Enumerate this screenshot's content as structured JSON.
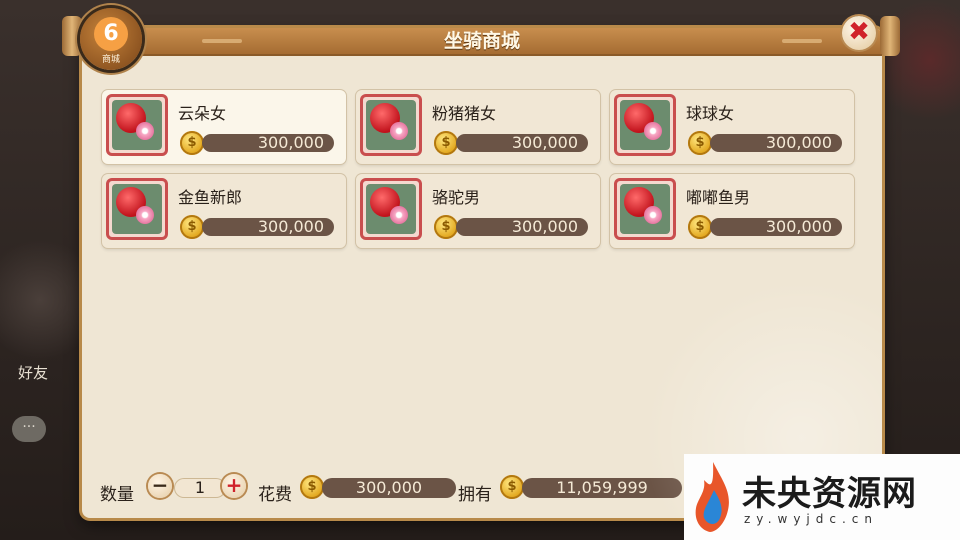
{
  "window": {
    "title": "坐骑商城"
  },
  "badge": {
    "glyph": "6",
    "label": "商城"
  },
  "close": {
    "glyph": "✖"
  },
  "currency_icon": "gold-coin-icon",
  "items": [
    {
      "name": "云朵女",
      "price": "300,000",
      "selected": true
    },
    {
      "name": "粉猪猪女",
      "price": "300,000"
    },
    {
      "name": "球球女",
      "price": "300,000"
    },
    {
      "name": "金鱼新郎",
      "price": "300,000"
    },
    {
      "name": "骆驼男",
      "price": "300,000"
    },
    {
      "name": "嘟嘟鱼男",
      "price": "300,000"
    }
  ],
  "bottom": {
    "qty_label": "数量",
    "minus": "−",
    "qty_value": "1",
    "plus": "+",
    "cost_label": "花费",
    "cost_value": "300,000",
    "owned_label": "拥有",
    "owned_value": "11,059,999"
  },
  "side": {
    "friend_label": "好友",
    "chat_glyph": "···"
  },
  "watermark": {
    "text": "未央资源网",
    "url": "zy.wyjdc.cn"
  },
  "colors": {
    "accent": "#c94e4e",
    "panel": "#efe6d4",
    "bar": "#6b5446",
    "coin": "#e0a318"
  }
}
